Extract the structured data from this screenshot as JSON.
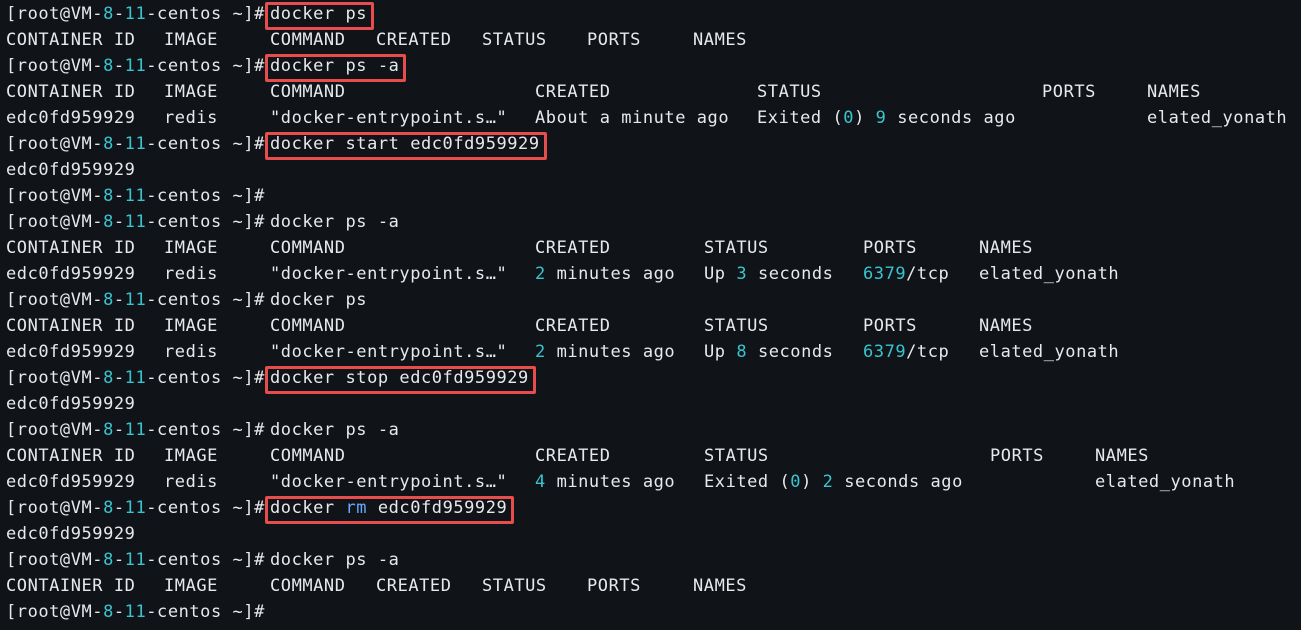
{
  "prompt": {
    "open": "[root@VM-",
    "n1": "8",
    "dash": "-",
    "n2": "11",
    "close": "-centos ~]#"
  },
  "lines": [
    {
      "kind": "prompt",
      "command": [
        {
          "t": "docker ps"
        }
      ],
      "highlighted": true
    },
    {
      "kind": "text",
      "cells": [
        [
          0,
          "CONTAINER ID"
        ],
        [
          158,
          "IMAGE"
        ],
        [
          264,
          "COMMAND"
        ],
        [
          370,
          "CREATED"
        ],
        [
          476,
          "STATUS"
        ],
        [
          581,
          "PORTS"
        ],
        [
          687,
          "NAMES"
        ]
      ]
    },
    {
      "kind": "prompt",
      "command": [
        {
          "t": "docker ps -a"
        }
      ],
      "highlighted": true
    },
    {
      "kind": "text",
      "cells": [
        [
          0,
          "CONTAINER ID"
        ],
        [
          158,
          "IMAGE"
        ],
        [
          264,
          "COMMAND"
        ],
        [
          529,
          "CREATED"
        ],
        [
          751,
          "STATUS"
        ],
        [
          1036,
          "PORTS"
        ],
        [
          1141,
          "NAMES"
        ]
      ]
    },
    {
      "kind": "text",
      "cells": [
        [
          0,
          "edc0fd959929"
        ],
        [
          158,
          "redis"
        ],
        [
          264,
          "\"docker-entrypoint.s…\""
        ],
        [
          529,
          "About a minute ago"
        ],
        [
          751,
          [
            {
              "t": "Exited ("
            },
            {
              "t": "0",
              "c": "num"
            },
            {
              "t": ") "
            },
            {
              "t": "9",
              "c": "num"
            },
            {
              "t": " seconds ago"
            }
          ]
        ],
        [
          1141,
          "elated_yonath"
        ]
      ]
    },
    {
      "kind": "prompt",
      "command": [
        {
          "t": "docker start edc0fd959929"
        }
      ],
      "highlighted": true
    },
    {
      "kind": "text",
      "cells": [
        [
          0,
          "edc0fd959929"
        ]
      ]
    },
    {
      "kind": "prompt",
      "command": [],
      "highlighted": false
    },
    {
      "kind": "prompt",
      "command": [
        {
          "t": "docker ps -a"
        }
      ],
      "highlighted": false
    },
    {
      "kind": "text",
      "cells": [
        [
          0,
          "CONTAINER ID"
        ],
        [
          158,
          "IMAGE"
        ],
        [
          264,
          "COMMAND"
        ],
        [
          529,
          "CREATED"
        ],
        [
          698,
          "STATUS"
        ],
        [
          857,
          "PORTS"
        ],
        [
          973,
          "NAMES"
        ]
      ]
    },
    {
      "kind": "text",
      "cells": [
        [
          0,
          "edc0fd959929"
        ],
        [
          158,
          "redis"
        ],
        [
          264,
          "\"docker-entrypoint.s…\""
        ],
        [
          529,
          [
            {
              "t": "2",
              "c": "num"
            },
            {
              "t": " minutes ago"
            }
          ]
        ],
        [
          698,
          [
            {
              "t": "Up "
            },
            {
              "t": "3",
              "c": "num"
            },
            {
              "t": " seconds"
            }
          ]
        ],
        [
          857,
          [
            {
              "t": "6379",
              "c": "num"
            },
            {
              "t": "/tcp"
            }
          ]
        ],
        [
          973,
          "elated_yonath"
        ]
      ]
    },
    {
      "kind": "prompt",
      "command": [
        {
          "t": "docker ps"
        }
      ],
      "highlighted": false
    },
    {
      "kind": "text",
      "cells": [
        [
          0,
          "CONTAINER ID"
        ],
        [
          158,
          "IMAGE"
        ],
        [
          264,
          "COMMAND"
        ],
        [
          529,
          "CREATED"
        ],
        [
          698,
          "STATUS"
        ],
        [
          857,
          "PORTS"
        ],
        [
          973,
          "NAMES"
        ]
      ]
    },
    {
      "kind": "text",
      "cells": [
        [
          0,
          "edc0fd959929"
        ],
        [
          158,
          "redis"
        ],
        [
          264,
          "\"docker-entrypoint.s…\""
        ],
        [
          529,
          [
            {
              "t": "2",
              "c": "num"
            },
            {
              "t": " minutes ago"
            }
          ]
        ],
        [
          698,
          [
            {
              "t": "Up "
            },
            {
              "t": "8",
              "c": "num"
            },
            {
              "t": " seconds"
            }
          ]
        ],
        [
          857,
          [
            {
              "t": "6379",
              "c": "num"
            },
            {
              "t": "/tcp"
            }
          ]
        ],
        [
          973,
          "elated_yonath"
        ]
      ]
    },
    {
      "kind": "prompt",
      "command": [
        {
          "t": "docker stop edc0fd959929"
        }
      ],
      "highlighted": true
    },
    {
      "kind": "text",
      "cells": [
        [
          0,
          "edc0fd959929"
        ]
      ]
    },
    {
      "kind": "prompt",
      "command": [
        {
          "t": "docker ps -a"
        }
      ],
      "highlighted": false
    },
    {
      "kind": "text",
      "cells": [
        [
          0,
          "CONTAINER ID"
        ],
        [
          158,
          "IMAGE"
        ],
        [
          264,
          "COMMAND"
        ],
        [
          529,
          "CREATED"
        ],
        [
          698,
          "STATUS"
        ],
        [
          984,
          "PORTS"
        ],
        [
          1089,
          "NAMES"
        ]
      ]
    },
    {
      "kind": "text",
      "cells": [
        [
          0,
          "edc0fd959929"
        ],
        [
          158,
          "redis"
        ],
        [
          264,
          "\"docker-entrypoint.s…\""
        ],
        [
          529,
          [
            {
              "t": "4",
              "c": "num"
            },
            {
              "t": " minutes ago"
            }
          ]
        ],
        [
          698,
          [
            {
              "t": "Exited ("
            },
            {
              "t": "0",
              "c": "num"
            },
            {
              "t": ") "
            },
            {
              "t": "2",
              "c": "num"
            },
            {
              "t": " seconds ago"
            }
          ]
        ],
        [
          1089,
          "elated_yonath"
        ]
      ]
    },
    {
      "kind": "prompt",
      "command": [
        {
          "t": "docker "
        },
        {
          "t": "rm",
          "c": "kw"
        },
        {
          "t": " edc0fd959929"
        }
      ],
      "highlighted": true
    },
    {
      "kind": "text",
      "cells": [
        [
          0,
          "edc0fd959929"
        ]
      ]
    },
    {
      "kind": "prompt",
      "command": [
        {
          "t": "docker ps -a"
        }
      ],
      "highlighted": false
    },
    {
      "kind": "text",
      "cells": [
        [
          0,
          "CONTAINER ID"
        ],
        [
          158,
          "IMAGE"
        ],
        [
          264,
          "COMMAND"
        ],
        [
          370,
          "CREATED"
        ],
        [
          476,
          "STATUS"
        ],
        [
          581,
          "PORTS"
        ],
        [
          687,
          "NAMES"
        ]
      ]
    },
    {
      "kind": "prompt",
      "command": [],
      "highlighted": false
    }
  ]
}
